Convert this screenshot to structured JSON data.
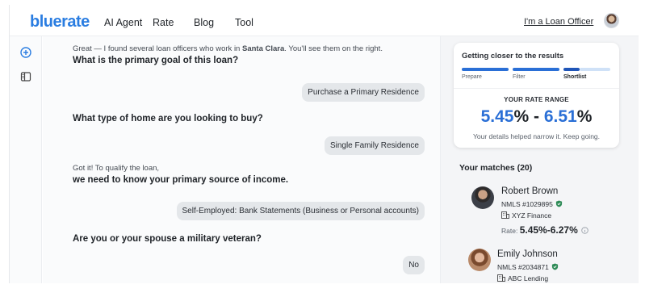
{
  "header": {
    "logo_b": "b",
    "logo_rest": "luerate",
    "nav": [
      "AI Agent",
      "Rate",
      "Blog",
      "Tool"
    ],
    "officer_link": "I'm a Loan Officer"
  },
  "rail": {
    "icons": [
      "plus-circle-icon",
      "sidebar-panel-icon"
    ]
  },
  "chat": {
    "intro_prefix": "Great — I found several loan officers who work in ",
    "intro_city": "Santa Clara",
    "intro_suffix": ". You'll see them on the right.",
    "q1": "What is the primary goal of this loan?",
    "a1": "Purchase a Primary Residence",
    "q2": "What type of home are you looking to buy?",
    "a2": "Single Family Residence",
    "q3_sub": "Got it! To qualify the loan,",
    "q3": "we need to know your primary source of income.",
    "a3": "Self-Employed: Bank Statements (Business or Personal accounts)",
    "q4": "Are you or your spouse a military veteran?",
    "a4": "No"
  },
  "progress": {
    "title": "Getting closer to the results",
    "steps": [
      "Prepare",
      "Filter",
      "Shortlist"
    ],
    "active_steps": 3,
    "current_step": "Shortlist",
    "range_label": "YOUR RATE RANGE",
    "rate_low": "5.45",
    "rate_high": "6.51",
    "pct": "%",
    "dash": "-",
    "note": "Your details helped narrow it. Keep going."
  },
  "matches": {
    "title": "Your matches (20)",
    "items": [
      {
        "name": "Robert Brown",
        "nmls": "NMLS #1029895",
        "company": "XYZ Finance",
        "rate_prefix": "Rate:",
        "rate": "5.45%-6.27%"
      },
      {
        "name": "Emily Johnson",
        "nmls": "NMLS #2034871",
        "company": "ABC Lending"
      }
    ]
  },
  "colors": {
    "brand": "#2a7de1",
    "progress_done": "#2a6fd6",
    "progress_todo": "#cfe1f7",
    "verified": "#2e8b57"
  }
}
